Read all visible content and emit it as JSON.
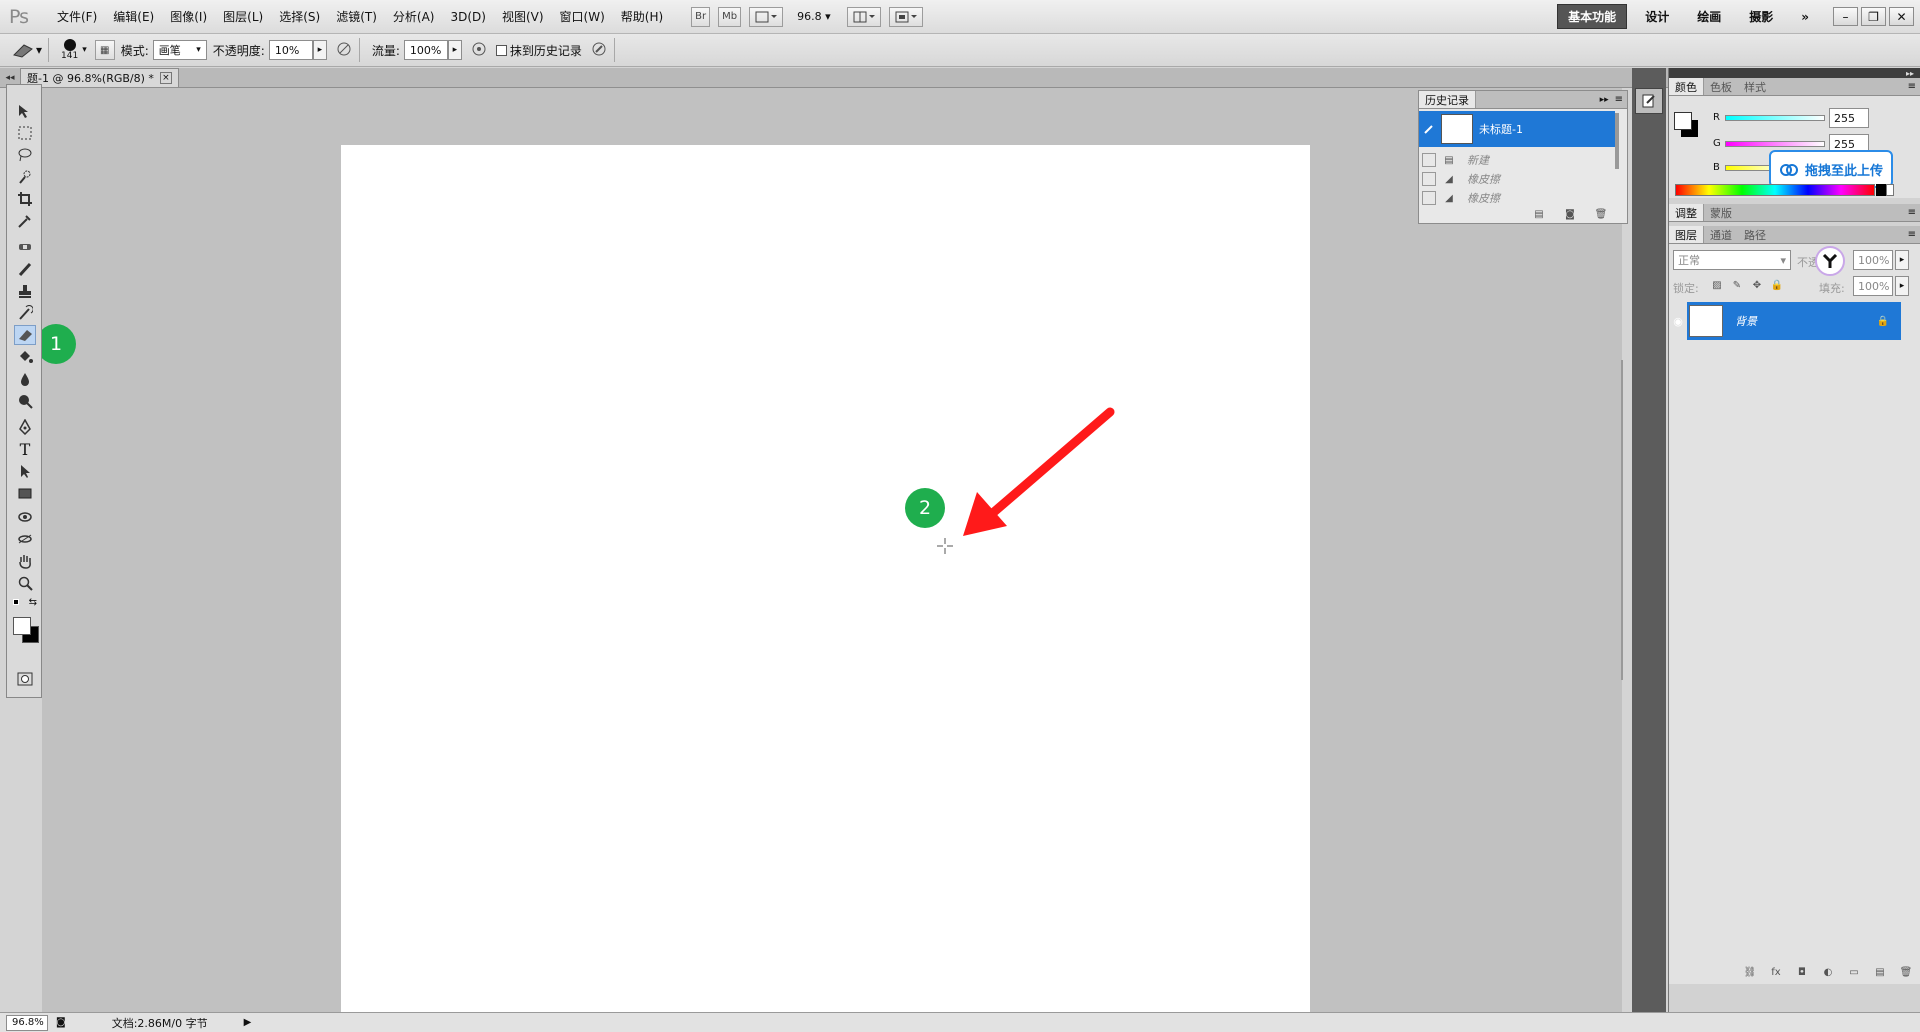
{
  "app": {
    "logo": "Ps"
  },
  "menu": [
    "文件(F)",
    "编辑(E)",
    "图像(I)",
    "图层(L)",
    "选择(S)",
    "滤镜(T)",
    "分析(A)",
    "3D(D)",
    "视图(V)",
    "窗口(W)",
    "帮助(H)"
  ],
  "menubar_tools": {
    "bridge": "Br",
    "mini_bridge": "Mb",
    "zoom": "96.8"
  },
  "workspaces": [
    "基本功能",
    "设计",
    "绘画",
    "摄影"
  ],
  "workspace_more": "»",
  "options": {
    "brush_size": "141",
    "mode_label": "模式:",
    "mode_value": "画笔",
    "opacity_label": "不透明度:",
    "opacity_value": "10%",
    "flow_label": "流量:",
    "flow_value": "100%",
    "erase_history_label": "抹到历史记录"
  },
  "document_tab": {
    "title": "题-1 @ 96.8%(RGB/8) *",
    "close": "×"
  },
  "history_panel": {
    "tab": "历史记录",
    "snapshot": "未标题-1",
    "states": [
      "新建",
      "橡皮擦",
      "橡皮擦"
    ]
  },
  "color_panel": {
    "tabs": [
      "颜色",
      "色板",
      "样式"
    ],
    "channels": [
      {
        "label": "R",
        "value": "255"
      },
      {
        "label": "G",
        "value": "255"
      },
      {
        "label": "B",
        "value": ""
      }
    ],
    "upload_button": "拖拽至此上传"
  },
  "adjust_panel": {
    "tabs": [
      "调整",
      "蒙版"
    ]
  },
  "layers_panel": {
    "tabs": [
      "图层",
      "通道",
      "路径"
    ],
    "blend_mode": "正常",
    "opacity_label": "不透",
    "opacity_value": "100%",
    "lock_label": "锁定:",
    "fill_label": "填充:",
    "fill_value": "100%",
    "layers": [
      {
        "name": "背景"
      }
    ]
  },
  "status": {
    "zoom": "96.8%",
    "doc_info": "文档:2.86M/0 字节"
  },
  "annotations": [
    "1",
    "2"
  ],
  "colors": {
    "accent": "#1f78d6",
    "badge": "#1fae4e",
    "arrow": "#ff1a1a"
  }
}
